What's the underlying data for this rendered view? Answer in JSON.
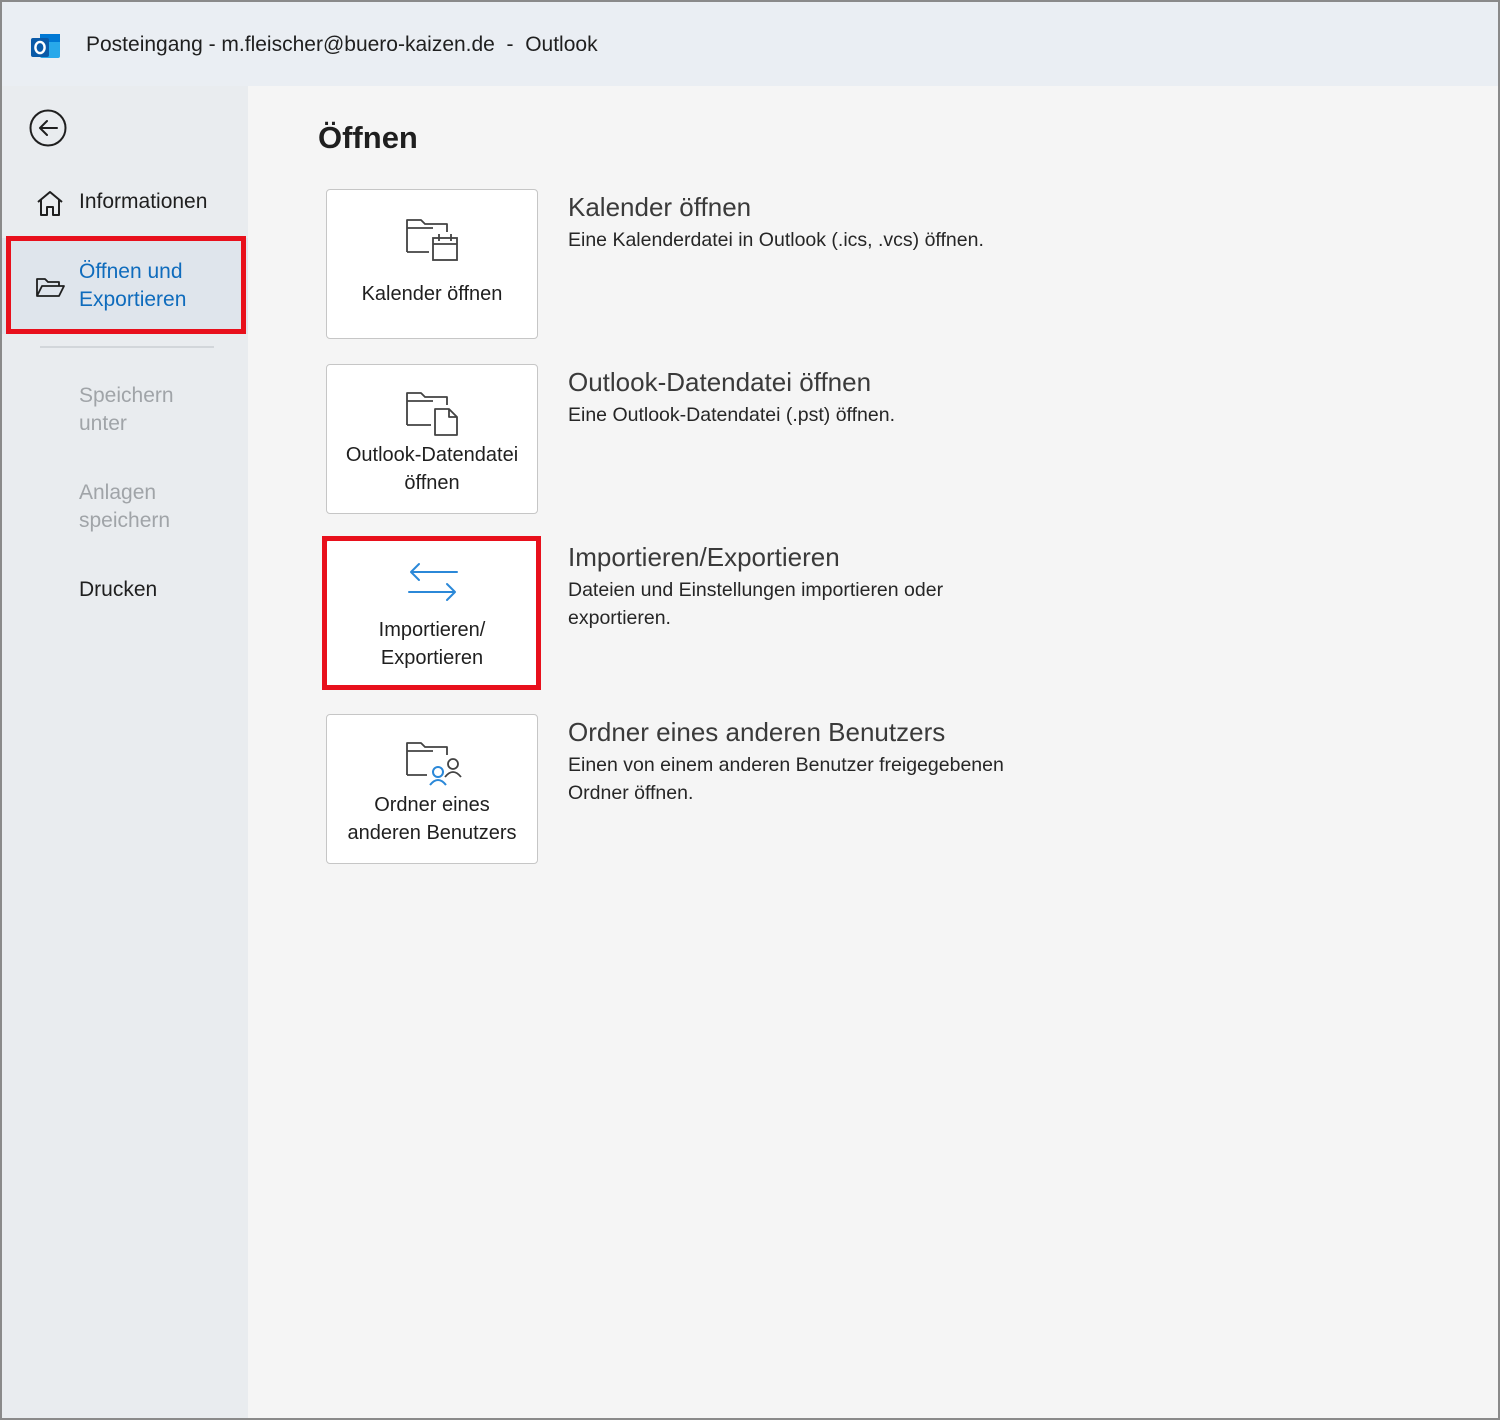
{
  "window": {
    "title": "Posteingang - m.fleischer@buero-kaizen.de  -  Outlook",
    "app_icon": "outlook-icon"
  },
  "sidebar": {
    "back_icon": "back-arrow-icon",
    "items": [
      {
        "label": "Informationen",
        "icon": "home-icon",
        "state": "normal"
      },
      {
        "label": "Öffnen und Exportieren",
        "icon": "folder-open-icon",
        "state": "selected"
      },
      {
        "label": "Speichern unter",
        "state": "disabled"
      },
      {
        "label": "Anlagen speichern",
        "state": "disabled"
      },
      {
        "label": "Drucken",
        "state": "normal"
      }
    ]
  },
  "main": {
    "title": "Öffnen",
    "options": [
      {
        "tile_label": "Kalender öffnen",
        "title": "Kalender öffnen",
        "description": "Eine Kalenderdatei in Outlook (.ics, .vcs) öffnen.",
        "icon": "folder-calendar-icon"
      },
      {
        "tile_label": "Outlook-Datendatei öffnen",
        "title": "Outlook-Datendatei öffnen",
        "description": "Eine Outlook-Datendatei (.pst) öffnen.",
        "icon": "folder-file-icon"
      },
      {
        "tile_label": "Importieren/ Exportieren",
        "title": "Importieren/Exportieren",
        "description": "Dateien und Einstellungen importieren oder exportieren.",
        "icon": "import-export-arrows-icon",
        "highlighted": true
      },
      {
        "tile_label": "Ordner eines anderen Benutzers",
        "title": "Ordner eines anderen Benutzers",
        "description": "Einen von einem anderen Benutzer freigegebenen Ordner öffnen.",
        "icon": "folder-users-icon"
      }
    ]
  },
  "colors": {
    "accent": "#0f6cbd",
    "highlight": "#e8101c",
    "disabled_text": "#a0a4a8"
  }
}
